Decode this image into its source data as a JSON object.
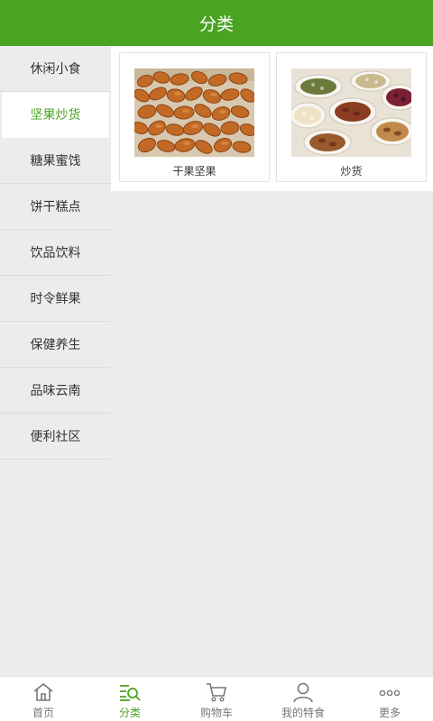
{
  "header": {
    "title": "分类"
  },
  "sidebar": {
    "items": [
      {
        "label": "休闲小食"
      },
      {
        "label": "坚果炒货"
      },
      {
        "label": "糖果蜜饯"
      },
      {
        "label": "饼干糕点"
      },
      {
        "label": "饮品饮料"
      },
      {
        "label": "时令鲜果"
      },
      {
        "label": "保健养生"
      },
      {
        "label": "品味云南"
      },
      {
        "label": "便利社区"
      }
    ],
    "active_index": 1
  },
  "content": {
    "cards": [
      {
        "label": "干果坚果",
        "image": "pine-nuts-photo"
      },
      {
        "label": "炒货",
        "image": "mixed-nuts-bowls-photo"
      }
    ]
  },
  "tabbar": {
    "tabs": [
      {
        "label": "首页",
        "icon": "home-icon"
      },
      {
        "label": "分类",
        "icon": "category-icon"
      },
      {
        "label": "购物车",
        "icon": "cart-icon"
      },
      {
        "label": "我的特食",
        "icon": "user-icon"
      },
      {
        "label": "更多",
        "icon": "more-icon"
      }
    ],
    "active_index": 1
  },
  "colors": {
    "brand": "#4aa321",
    "background": "#ececec"
  }
}
